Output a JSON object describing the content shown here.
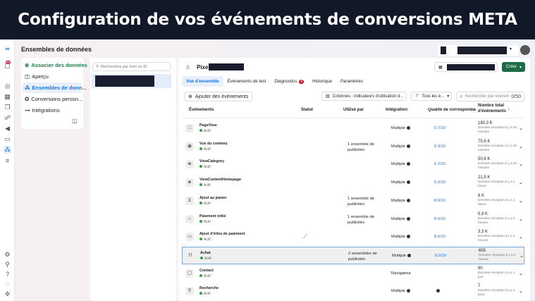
{
  "banner": "Configuration de vos événements de conversions META",
  "app_title": "Ensembles de données",
  "left_nav": [
    {
      "label": "Associer des données",
      "icon": "plus-circle-icon"
    },
    {
      "label": "Aperçu",
      "icon": "layout-icon"
    },
    {
      "label": "Ensembles de donn...",
      "icon": "datasets-icon"
    },
    {
      "label": "Conversions person...",
      "icon": "custom-conversions-icon"
    },
    {
      "label": "Intégrations",
      "icon": "integrations-icon"
    }
  ],
  "notif_count": "99",
  "search_placeholder": "Recherchez par nom ou ID",
  "pixel_label": "Pixel",
  "create_label": "Créer",
  "tabs": [
    {
      "label": "Vue d'ensemble"
    },
    {
      "label": "Événements de test"
    },
    {
      "label": "Diagnostics",
      "badge": "6"
    },
    {
      "label": "Historique"
    },
    {
      "label": "Paramètres"
    }
  ],
  "add_events_label": "Ajouter des événements",
  "columns_label": "Colonnes : indicateurs d'utilisation d...",
  "filter_label": "Tous les é...",
  "event_search_placeholder": "Rechercher par événement",
  "event_search_count": "0/50",
  "headers": {
    "events": "Événements",
    "status": "Statut",
    "used_by": "Utilisé par",
    "integration": "Intégration",
    "quality": "Qualité de correspondanc...",
    "total": "Nombre total d'événements"
  },
  "rows": [
    {
      "name": "PageView",
      "status": "Actif",
      "used": "",
      "integ": "Multiple",
      "qual": "5.7/10",
      "total": "180,3 K",
      "last": "Dernière réception il y a 28 minutes",
      "icon": "□"
    },
    {
      "name": "Vue du contenu",
      "status": "Actif",
      "used": "1 ensemble de publicités",
      "integ": "Multiple",
      "qual": "5.3/10",
      "total": "75,6 K",
      "last": "Dernière réception il y a 28 minutes",
      "icon": "◉"
    },
    {
      "name": "ViewCategory",
      "status": "Actif",
      "used": "",
      "integ": "Multiple",
      "qual": "6.7/10",
      "total": "50,8 K",
      "last": "Dernière réception il y a 29 minutes",
      "icon": "◈"
    },
    {
      "name": "ViewContentHomepage",
      "status": "Actif",
      "used": "",
      "integ": "Multiple",
      "qual": "5.2/10",
      "total": "21,9 K",
      "last": "Dernière réception il y a 1 heure",
      "icon": "◈"
    },
    {
      "name": "Ajout au panier",
      "status": "Actif",
      "used": "1 ensemble de publicités",
      "integ": "Multiple",
      "qual": "8.0/10",
      "total": "8 K",
      "last": "Dernière réception il y a 1 heure",
      "icon": "⊻"
    },
    {
      "name": "Paiement initié",
      "status": "Actif",
      "used": "1 ensemble de publicités",
      "integ": "Multiple",
      "qual": "8.0/10",
      "total": "5,9 K",
      "last": "Dernière réception il y a 2 heures",
      "icon": "⌂"
    },
    {
      "name": "Ajout d'infos de paiement",
      "status": "Actif",
      "used": "",
      "integ": "Multiple",
      "qual": "8.0/10",
      "total": "3,3 K",
      "last": "Dernière réception il y a 4 heures",
      "icon": "▭"
    },
    {
      "name": "Achat",
      "status": "Actif",
      "used": "2 ensembles de publicités",
      "integ": "Multiple",
      "qual": "8.0/10",
      "total": "655",
      "last": "Dernière réception il y a 4 heures",
      "icon": "⊓"
    },
    {
      "name": "Contact",
      "status": "Actif",
      "used": "",
      "integ": "Navigateur",
      "qual": "",
      "total": "90",
      "last": "Dernière réception il y a 1 jour",
      "icon": "▢"
    },
    {
      "name": "Recherche",
      "status": "Actif",
      "used": "",
      "integ": "Multiple",
      "qual": "",
      "total": "7",
      "last": "Dernière réception il y a 4 jours",
      "icon": "⚲"
    }
  ]
}
